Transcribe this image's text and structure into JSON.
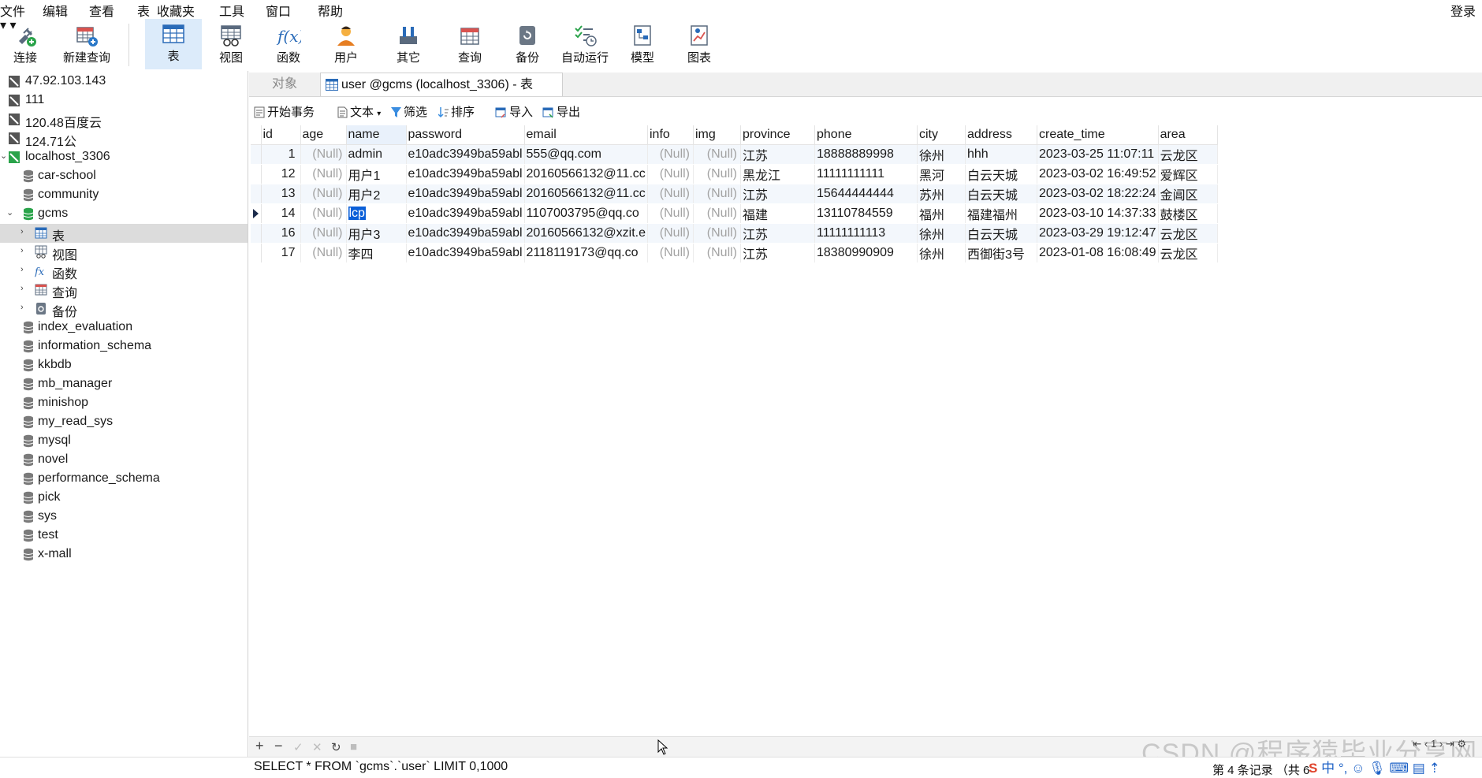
{
  "menu": {
    "items": [
      "文件",
      "编辑",
      "查看",
      "表",
      "收藏夹",
      "工具",
      "窗口",
      "帮助"
    ],
    "login": "登录"
  },
  "toolbar": {
    "connect": "连接",
    "new_query": "新建查询",
    "table": "表",
    "view": "视图",
    "function": "函数",
    "user": "用户",
    "other": "其它",
    "query": "查询",
    "backup": "备份",
    "automation": "自动运行",
    "model": "模型",
    "chart": "图表"
  },
  "navigator": {
    "connections": [
      "47.92.103.143",
      "111",
      "120.48百度云",
      "124.71公"
    ],
    "local_conn": "localhost_3306",
    "databases_before": [
      "car-school",
      "community"
    ],
    "open_db": "gcms",
    "open_db_children": [
      "表",
      "视图",
      "函数",
      "查询",
      "备份"
    ],
    "databases_after": [
      "index_evaluation",
      "information_schema",
      "kkbdb",
      "mb_manager",
      "minishop",
      "my_read_sys",
      "mysql",
      "novel",
      "performance_schema",
      "pick",
      "sys",
      "test",
      "x-mall"
    ]
  },
  "tabs": {
    "objects": "对象",
    "current": "user @gcms (localhost_3306) - 表"
  },
  "table_toolbar": {
    "begin_tx": "开始事务",
    "text": "文本",
    "filter": "筛选",
    "sort": "排序",
    "import": "导入",
    "export": "导出"
  },
  "grid": {
    "columns": [
      "id",
      "age",
      "name",
      "password",
      "email",
      "info",
      "img",
      "province",
      "phone",
      "city",
      "address",
      "create_time",
      "area"
    ],
    "rows": [
      {
        "id": "1",
        "age": "(Null)",
        "name": "admin",
        "password": "e10adc3949ba59abl",
        "email": "555@qq.com",
        "info": "(Null)",
        "img": "(Null)",
        "province": "江苏",
        "phone": "18888889998",
        "city": "徐州",
        "address": "hhh",
        "create_time": "2023-03-25 11:07:11",
        "area": "云龙区"
      },
      {
        "id": "12",
        "age": "(Null)",
        "name": "用户1",
        "password": "e10adc3949ba59abl",
        "email": "20160566132@11.cc",
        "info": "(Null)",
        "img": "(Null)",
        "province": "黑龙江",
        "phone": "11111111111",
        "city": "黑河",
        "address": "白云天城",
        "create_time": "2023-03-02 16:49:52",
        "area": "爱辉区"
      },
      {
        "id": "13",
        "age": "(Null)",
        "name": "用户2",
        "password": "e10adc3949ba59abl",
        "email": "20160566132@11.cc",
        "info": "(Null)",
        "img": "(Null)",
        "province": "江苏",
        "phone": "15644444444",
        "city": "苏州",
        "address": "白云天城",
        "create_time": "2023-03-02 18:22:24",
        "area": "金阊区"
      },
      {
        "id": "14",
        "age": "(Null)",
        "name": "lcp",
        "password": "e10adc3949ba59abl",
        "email": "1107003795@qq.co",
        "info": "(Null)",
        "img": "(Null)",
        "province": "福建",
        "phone": "13110784559",
        "city": "福州",
        "address": "福建福州",
        "create_time": "2023-03-10 14:37:33",
        "area": "鼓楼区"
      },
      {
        "id": "16",
        "age": "(Null)",
        "name": "用户3",
        "password": "e10adc3949ba59abl",
        "email": "20160566132@xzit.e",
        "info": "(Null)",
        "img": "(Null)",
        "province": "江苏",
        "phone": "11111111113",
        "city": "徐州",
        "address": "白云天城",
        "create_time": "2023-03-29 19:12:47",
        "area": "云龙区"
      },
      {
        "id": "17",
        "age": "(Null)",
        "name": "李四",
        "password": "e10adc3949ba59abl",
        "email": "2118119173@qq.co",
        "info": "(Null)",
        "img": "(Null)",
        "province": "江苏",
        "phone": "18380990909",
        "city": "徐州",
        "address": "西御街3号",
        "create_time": "2023-01-08 16:08:49",
        "area": "云龙区"
      }
    ],
    "current_row_index": 3
  },
  "bottom": {
    "nav_buttons": [
      "+",
      "−",
      "✓",
      "✕",
      "↻",
      "■"
    ],
    "sql": "SELECT * FROM `gcms`.`user` LIMIT 0,1000",
    "record_info": "第 4 条记录 （共 6",
    "page": "1"
  },
  "watermark": "CSDN @程序猿毕业分享网",
  "ime_indicator": "中"
}
